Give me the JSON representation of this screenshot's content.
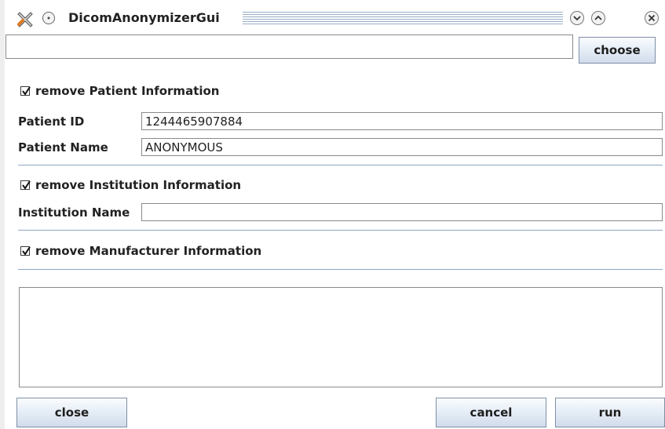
{
  "window": {
    "title": "DicomAnonymizerGui",
    "icons": {
      "app": "crossed-tools-icon",
      "menu": "window-menu-icon",
      "minimize": "minimize-icon",
      "maximize": "maximize-icon",
      "close": "close-icon"
    }
  },
  "file": {
    "path_value": "",
    "choose_label": "choose"
  },
  "patient": {
    "checkbox_label": "remove Patient Information",
    "checked": true,
    "id_label": "Patient ID",
    "id_value": "1244465907884",
    "name_label": "Patient Name",
    "name_value": "ANONYMOUS"
  },
  "institution": {
    "checkbox_label": "remove Institution Information",
    "checked": true,
    "name_label": "Institution Name",
    "name_value": ""
  },
  "manufacturer": {
    "checkbox_label": "remove Manufacturer Information",
    "checked": true
  },
  "log": {
    "text": ""
  },
  "actions": {
    "close_label": "close",
    "cancel_label": "cancel",
    "run_label": "run"
  },
  "colors": {
    "separator": "#8fa6c7",
    "button_border": "#7d8fa7",
    "grip": "#9aaec8"
  }
}
